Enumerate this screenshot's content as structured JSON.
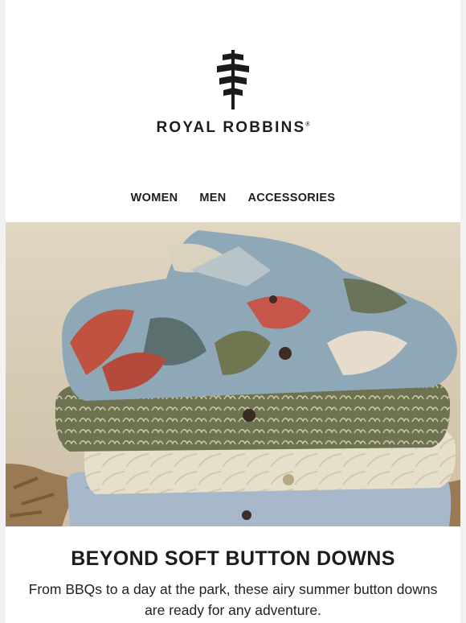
{
  "brand": {
    "logo_icon": "tree-signpost-icon",
    "name": "ROYAL ROBBINS",
    "registered": "®"
  },
  "nav": {
    "items": [
      {
        "label": "WOMEN"
      },
      {
        "label": "MEN"
      },
      {
        "label": "ACCESSORIES"
      }
    ]
  },
  "hero": {
    "image_icon": "folded-button-down-shirts-photo",
    "colors": {
      "background": "#d9cdb9",
      "shirt_top": "#8aa5b6",
      "shirt_olive": "#6f7450",
      "shirt_cream": "#e8e1cd",
      "shirt_blue": "#a4b6c8"
    }
  },
  "content": {
    "headline": "BEYOND SOFT BUTTON DOWNS",
    "body": "From BBQs to a day at the park, these airy summer button downs are ready for any adventure."
  }
}
